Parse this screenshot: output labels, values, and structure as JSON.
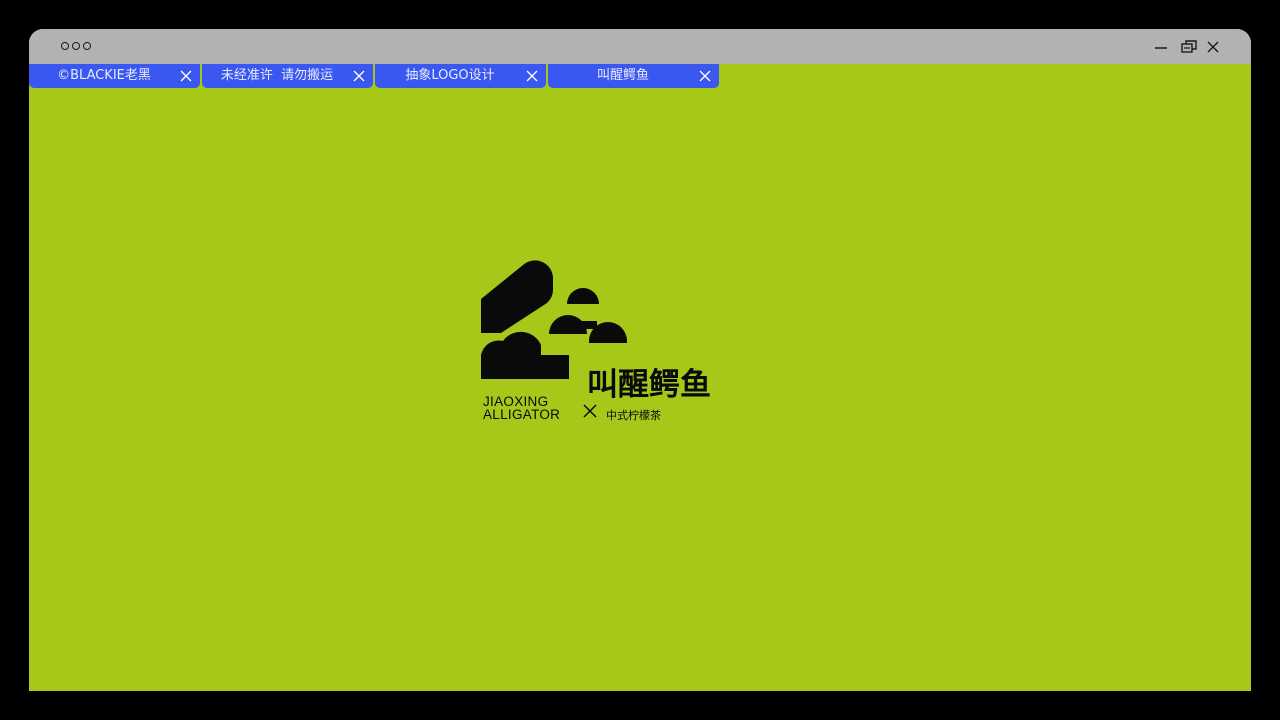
{
  "window": {
    "background": "#a5c819",
    "titlebar_color": "#b2b2b2"
  },
  "titlebar": {
    "dots_icon": "three-dots-icon",
    "controls": [
      "minimize-icon",
      "restore-icon",
      "close-icon"
    ]
  },
  "tabs": [
    {
      "label": "©BLACKIE老黑",
      "close_icon": "close-icon"
    },
    {
      "label": "未经准许  请勿搬运",
      "close_icon": "close-icon"
    },
    {
      "label": "抽象LOGO设计",
      "close_icon": "close-icon"
    },
    {
      "label": "叫醒鳄鱼",
      "close_icon": "close-icon"
    }
  ],
  "tab_color": "#3a57f0",
  "logo": {
    "cn_name": "叫醒鳄鱼",
    "en_name_line1": "JIAOXING",
    "en_name_line2": "ALLIGATOR",
    "collab": "中式柠檬茶",
    "ink_color": "#0a0a0a"
  }
}
